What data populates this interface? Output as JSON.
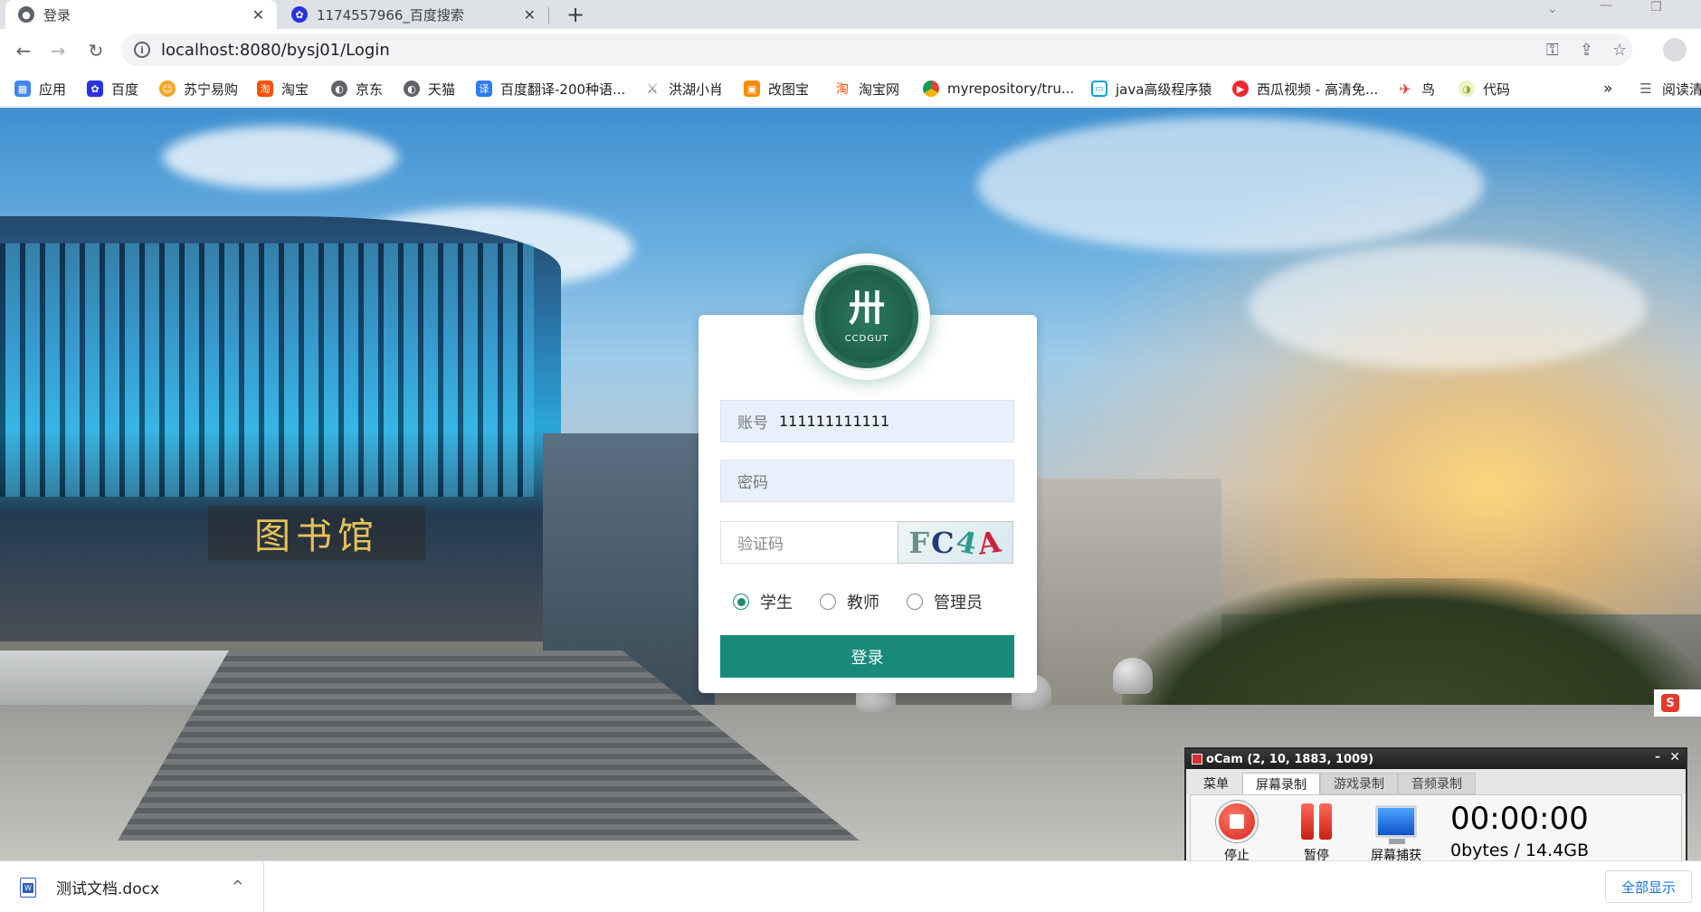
{
  "tabs": [
    {
      "title": "登录",
      "active": true
    },
    {
      "title": "1174557966_百度搜索",
      "active": false
    }
  ],
  "toolbar": {
    "url": "localhost:8080/bysj01/Login"
  },
  "bookmarks": [
    {
      "label": "应用",
      "icon": "apps-grid-icon",
      "color": "#4285f4"
    },
    {
      "label": "百度",
      "icon": "baidu-paw-icon",
      "color": "#2932e1"
    },
    {
      "label": "苏宁易购",
      "icon": "suning-lion-icon",
      "color": "#f5a623"
    },
    {
      "label": "淘宝",
      "icon": "taobao-icon",
      "color": "#ff5000"
    },
    {
      "label": "京东",
      "icon": "globe-icon",
      "color": "#5f6368"
    },
    {
      "label": "天猫",
      "icon": "globe-icon",
      "color": "#5f6368"
    },
    {
      "label": "百度翻译-200种语...",
      "icon": "translate-icon",
      "color": "#2f7bf5"
    },
    {
      "label": "洪湖小肖",
      "icon": "sword-icon",
      "color": "#777777"
    },
    {
      "label": "改图宝",
      "icon": "gaitubao-icon",
      "color": "#ff8a00"
    },
    {
      "label": "淘宝网",
      "icon": "taobao-icon",
      "color": "#ff5000"
    },
    {
      "label": "myrepository/tru...",
      "icon": "chrome-icon",
      "color": "#db4437"
    },
    {
      "label": "java高级程序猿",
      "icon": "bilibili-tv-icon",
      "color": "#00a1d6"
    },
    {
      "label": "西瓜视频 - 高清免...",
      "icon": "xigua-play-icon",
      "color": "#f0262b"
    },
    {
      "label": "鸟",
      "icon": "bird-icon",
      "color": "#e53b2c"
    },
    {
      "label": "代码",
      "icon": "leaf-icon",
      "color": "#c9d67a"
    }
  ],
  "bookmarks_overflow": "»",
  "reading_list": "阅读清",
  "login": {
    "account_label": "账号",
    "account_value": "111111111111",
    "password_label": "密码",
    "captcha_placeholder": "验证码",
    "captcha_chars": [
      "F",
      "C",
      "4",
      "A"
    ],
    "roles": [
      {
        "label": "学生",
        "selected": true
      },
      {
        "label": "教师",
        "selected": false
      },
      {
        "label": "管理员",
        "selected": false
      }
    ],
    "submit_label": "登录",
    "logo_mark": "卅",
    "logo_text": "CCDGUT"
  },
  "campus_sign": "图书馆",
  "ocam": {
    "title": "oCam (2, 10, 1883, 1009)",
    "tabs": [
      "菜单",
      "屏幕录制",
      "游戏录制",
      "音频录制"
    ],
    "active_tab": "屏幕录制",
    "buttons": [
      "停止",
      "暂停",
      "屏幕捕获"
    ],
    "timer": "00:00:00",
    "size": "0bytes / 14.4GB"
  },
  "download": {
    "filename": "测试文档.docx",
    "show_all": "全部显示"
  },
  "colors": {
    "accent": "#19897a",
    "tabstrip": "#dee1e6"
  }
}
